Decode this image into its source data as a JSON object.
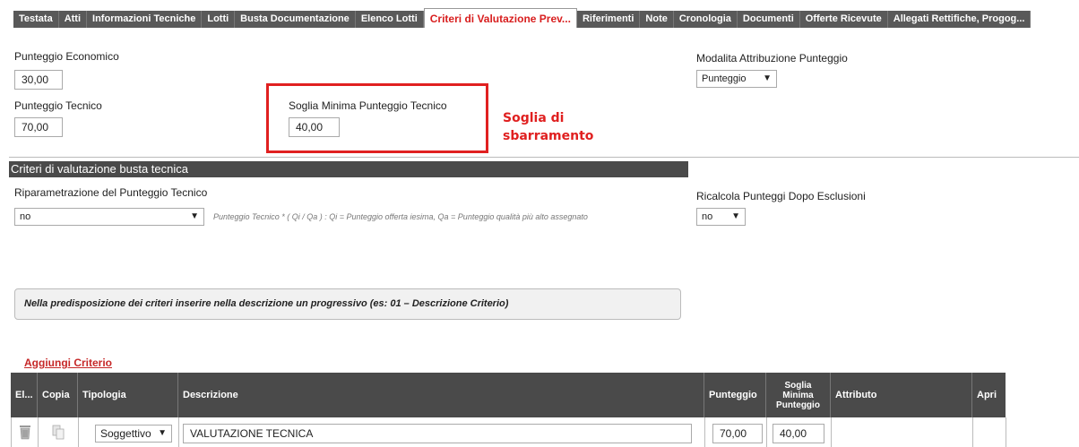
{
  "tabs": [
    {
      "label": "Testata",
      "active": false
    },
    {
      "label": "Atti",
      "active": false
    },
    {
      "label": "Informazioni Tecniche",
      "active": false
    },
    {
      "label": "Lotti",
      "active": false
    },
    {
      "label": "Busta Documentazione",
      "active": false
    },
    {
      "label": "Elenco Lotti",
      "active": false
    },
    {
      "label": "Criteri di Valutazione Prev...",
      "active": true
    },
    {
      "label": "Riferimenti",
      "active": false
    },
    {
      "label": "Note",
      "active": false
    },
    {
      "label": "Cronologia",
      "active": false
    },
    {
      "label": "Documenti",
      "active": false
    },
    {
      "label": "Offerte Ricevute",
      "active": false
    },
    {
      "label": "Allegati Rettifiche, Progog...",
      "active": false
    }
  ],
  "form": {
    "punteggio_economico_label": "Punteggio Economico",
    "punteggio_economico_value": "30,00",
    "punteggio_tecnico_label": "Punteggio Tecnico",
    "punteggio_tecnico_value": "70,00",
    "soglia_label": "Soglia Minima Punteggio Tecnico",
    "soglia_value": "40,00",
    "modalita_label": "Modalita Attribuzione Punteggio",
    "modalita_value": "Punteggio"
  },
  "annotation": {
    "line1": "Soglia di",
    "line2": "sbarramento",
    "color": "#e02020"
  },
  "section": {
    "title": "Criteri di valutazione busta tecnica",
    "riparam_label": "Riparametrazione del Punteggio Tecnico",
    "riparam_value": "no",
    "formula_note": "Punteggio Tecnico * ( Qi / Qa ) : Qi = Punteggio offerta iesima, Qa = Punteggio qualità più alto assegnato",
    "ricalcola_label": "Ricalcola Punteggi Dopo Esclusioni",
    "ricalcola_value": "no"
  },
  "info_message": "Nella predisposizione dei criteri inserire nella descrizione un progressivo (es: 01 – Descrizione Criterio)",
  "add_link": "Aggiungi Criterio",
  "table": {
    "headers": {
      "el": "El...",
      "copia": "Copia",
      "tipologia": "Tipologia",
      "descrizione": "Descrizione",
      "punteggio": "Punteggio",
      "soglia_1": "Soglia",
      "soglia_2": "Minima",
      "soglia_3": "Punteggio",
      "attributo": "Attributo",
      "apri": "Apri"
    },
    "rows": [
      {
        "tipologia": "Soggettivo",
        "descrizione": "VALUTAZIONE TECNICA",
        "punteggio": "70,00",
        "soglia": "40,00"
      }
    ]
  }
}
